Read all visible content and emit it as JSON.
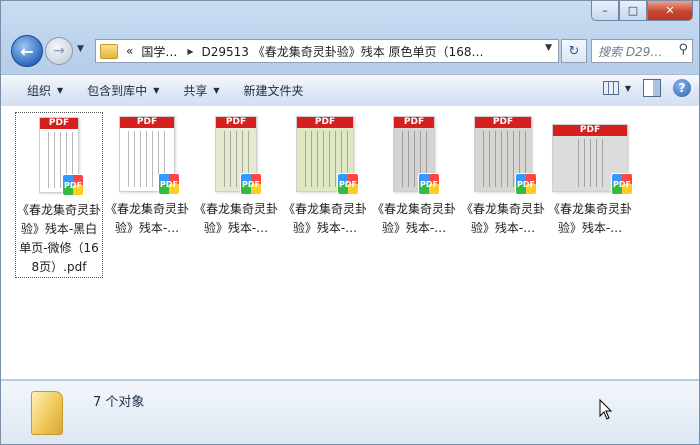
{
  "window": {
    "caption_buttons": [
      "–",
      "□",
      "✕"
    ]
  },
  "nav": {
    "back_glyph": "←",
    "forward_glyph": "→",
    "address_chevron": "«",
    "address_segments": [
      "国学…",
      "D29513 《春龙集奇灵卦验》残本 原色单页（168…"
    ],
    "refresh_glyph": "↻",
    "search_placeholder": "搜索 D29…"
  },
  "toolbar": {
    "organize": "组织",
    "include_library": "包含到库中",
    "share": "共享",
    "new_folder": "新建文件夹",
    "help": "?"
  },
  "files": [
    {
      "label": "《春龙集奇灵卦验》残本-黑白单页-微修（168页）.pdf",
      "selected": true,
      "tint": "#ffffff",
      "pdf": "PDF"
    },
    {
      "label": "《春龙集奇灵卦验》残本-…",
      "selected": false,
      "tint": "#ffffff",
      "pdf": "PDF"
    },
    {
      "label": "《春龙集奇灵卦验》残本-…",
      "selected": false,
      "tint": "#e3ead0",
      "pdf": "PDF"
    },
    {
      "label": "《春龙集奇灵卦验》残本-…",
      "selected": false,
      "tint": "#dfe8c4",
      "pdf": "PDF"
    },
    {
      "label": "《春龙集奇灵卦验》残本-…",
      "selected": false,
      "tint": "#d4d4d4",
      "pdf": "PDF"
    },
    {
      "label": "《春龙集奇灵卦验》残本-…",
      "selected": false,
      "tint": "#d8d6d2",
      "pdf": "PDF"
    },
    {
      "label": "《春龙集奇灵卦验》残本-…",
      "selected": false,
      "tint": "#dcdcdc",
      "pdf": "PDF"
    }
  ],
  "details": {
    "count_text": "7 个对象"
  },
  "colors": {
    "pdf_red": "#d61f1f",
    "accent": "#2d6cc0"
  }
}
